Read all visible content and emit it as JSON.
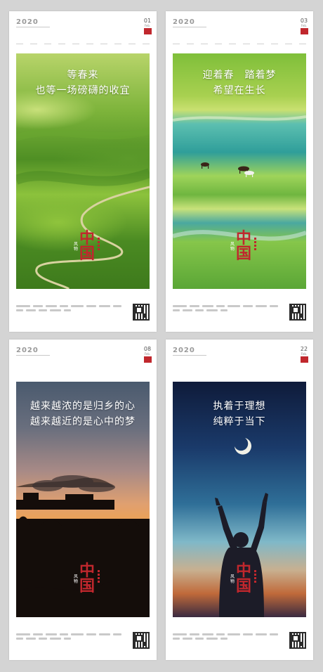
{
  "logo_text": "2020",
  "cards": [
    {
      "date": "01",
      "month": "Feb.",
      "headline": [
        "等春来",
        "也等一场磅礴的收宜"
      ],
      "seal_main": [
        "中",
        "国"
      ],
      "seal_small": "风物",
      "scene": "green-rolling-hills"
    },
    {
      "date": "03",
      "month": "Feb.",
      "headline": [
        "迎着春　踏着梦",
        "希望在生长"
      ],
      "seal_main": [
        "中",
        "国"
      ],
      "seal_small": "风物",
      "scene": "river-grassland-horses"
    },
    {
      "date": "08",
      "month": "Feb.",
      "headline": [
        "越来越浓的是归乡的心",
        "越来越近的是心中的梦"
      ],
      "seal_main": [
        "中",
        "国"
      ],
      "seal_small": "风物",
      "scene": "sunset-train-bridge"
    },
    {
      "date": "22",
      "month": "Feb.",
      "headline": [
        "执着于理想",
        "纯粹于当下"
      ],
      "seal_main": [
        "中",
        "国"
      ],
      "seal_small": "风物",
      "scene": "night-sky-person-moon"
    }
  ],
  "colors": {
    "accent_red": "#c0272d",
    "card_bg": "#ffffff",
    "page_bg": "#d4d4d4"
  }
}
